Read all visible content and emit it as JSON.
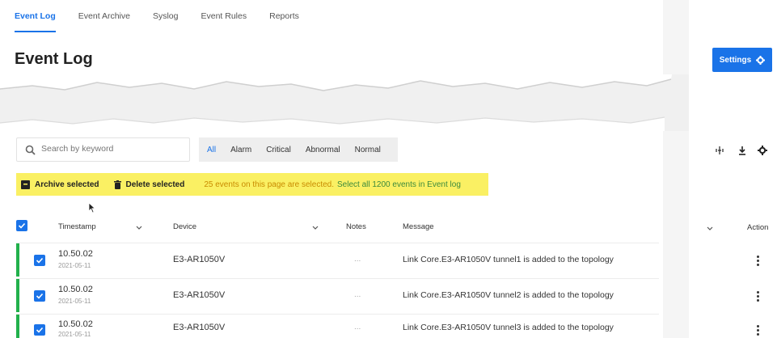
{
  "tabs": [
    {
      "label": "Event Log",
      "active": true
    },
    {
      "label": "Event Archive",
      "active": false
    },
    {
      "label": "Syslog",
      "active": false
    },
    {
      "label": "Event Rules",
      "active": false
    },
    {
      "label": "Reports",
      "active": false
    }
  ],
  "page_title": "Event Log",
  "settings_label": "Settings",
  "search": {
    "placeholder": "Search by keyword"
  },
  "filters": [
    "All",
    "Alarm",
    "Critical",
    "Abnormal",
    "Normal"
  ],
  "active_filter": "All",
  "selection_bar": {
    "archive_label": "Archive selected",
    "delete_label": "Delete selected",
    "message": "25 events on this page are selected.",
    "select_all_link": "Select all 1200 events in Event log"
  },
  "table": {
    "columns": {
      "timestamp": "Timestamp",
      "device": "Device",
      "notes": "Notes",
      "message": "Message",
      "action": "Action"
    },
    "rows": [
      {
        "time": "10.50.02",
        "date": "2021-05-11",
        "device": "E3-AR1050V",
        "notes": "...",
        "message": "Link Core.E3-AR1050V tunnel1 is added to the topology"
      },
      {
        "time": "10.50.02",
        "date": "2021-05-11",
        "device": "E3-AR1050V",
        "notes": "...",
        "message": "Link Core.E3-AR1050V tunnel2 is added to the topology"
      },
      {
        "time": "10.50.02",
        "date": "2021-05-11",
        "device": "E3-AR1050V",
        "notes": "...",
        "message": "Link Core.E3-AR1050V tunnel3 is added to the topology"
      }
    ]
  },
  "colors": {
    "accent": "#1a73e8",
    "highlight": "#faf063",
    "status_green": "#22b14c"
  },
  "icons": [
    "search-icon",
    "archive-icon",
    "trash-icon",
    "columns-icon",
    "download-icon",
    "gear-icon",
    "chevron-down-icon",
    "more-vertical-icon",
    "checkbox-checked-icon",
    "cursor-icon"
  ]
}
